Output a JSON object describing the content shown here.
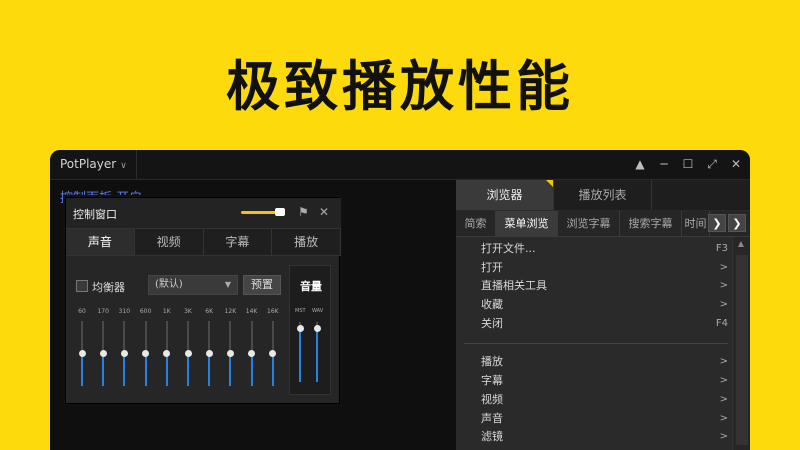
{
  "headline": "极致播放性能",
  "app": {
    "title": "PotPlayer",
    "bg_text": "控制面板    开启"
  },
  "control_panel": {
    "title": "控制窗口",
    "tabs": [
      "声音",
      "视频",
      "字幕",
      "播放"
    ],
    "equalizer_label": "均衡器",
    "preset_value": "(默认)",
    "preset_button": "预置",
    "header_slider_level": 0.82,
    "bands": [
      {
        "label": "60",
        "level": 0.5
      },
      {
        "label": "170",
        "level": 0.5
      },
      {
        "label": "310",
        "level": 0.5
      },
      {
        "label": "600",
        "level": 0.5
      },
      {
        "label": "1K",
        "level": 0.5
      },
      {
        "label": "3K",
        "level": 0.5
      },
      {
        "label": "6K",
        "level": 0.5
      },
      {
        "label": "12K",
        "level": 0.5
      },
      {
        "label": "14K",
        "level": 0.5
      },
      {
        "label": "16K",
        "level": 0.5
      }
    ],
    "volume": {
      "label": "音量",
      "channels": [
        {
          "label": "MST",
          "level": 0.9
        },
        {
          "label": "WAV",
          "level": 0.9
        }
      ]
    }
  },
  "pane": {
    "top_tabs": [
      "浏览器",
      "播放列表"
    ],
    "sub_tabs": [
      "简索",
      "菜单浏览",
      "浏览字幕",
      "搜索字幕",
      "时间"
    ],
    "menu_group1": [
      {
        "label": "打开文件...",
        "shortcut": "F3"
      },
      {
        "label": "打开",
        "shortcut": ">"
      },
      {
        "label": "直播相关工具",
        "shortcut": ">"
      },
      {
        "label": "收藏",
        "shortcut": ">"
      },
      {
        "label": "关闭",
        "shortcut": "F4"
      }
    ],
    "menu_group2": [
      {
        "label": "播放",
        "shortcut": ">"
      },
      {
        "label": "字幕",
        "shortcut": ">"
      },
      {
        "label": "视频",
        "shortcut": ">"
      },
      {
        "label": "声音",
        "shortcut": ">"
      },
      {
        "label": "滤镜",
        "shortcut": ">"
      }
    ]
  },
  "colors": {
    "background": "#FCDA0B",
    "accent": "#F2C50C",
    "slider_fill": "#2A7FE0"
  }
}
